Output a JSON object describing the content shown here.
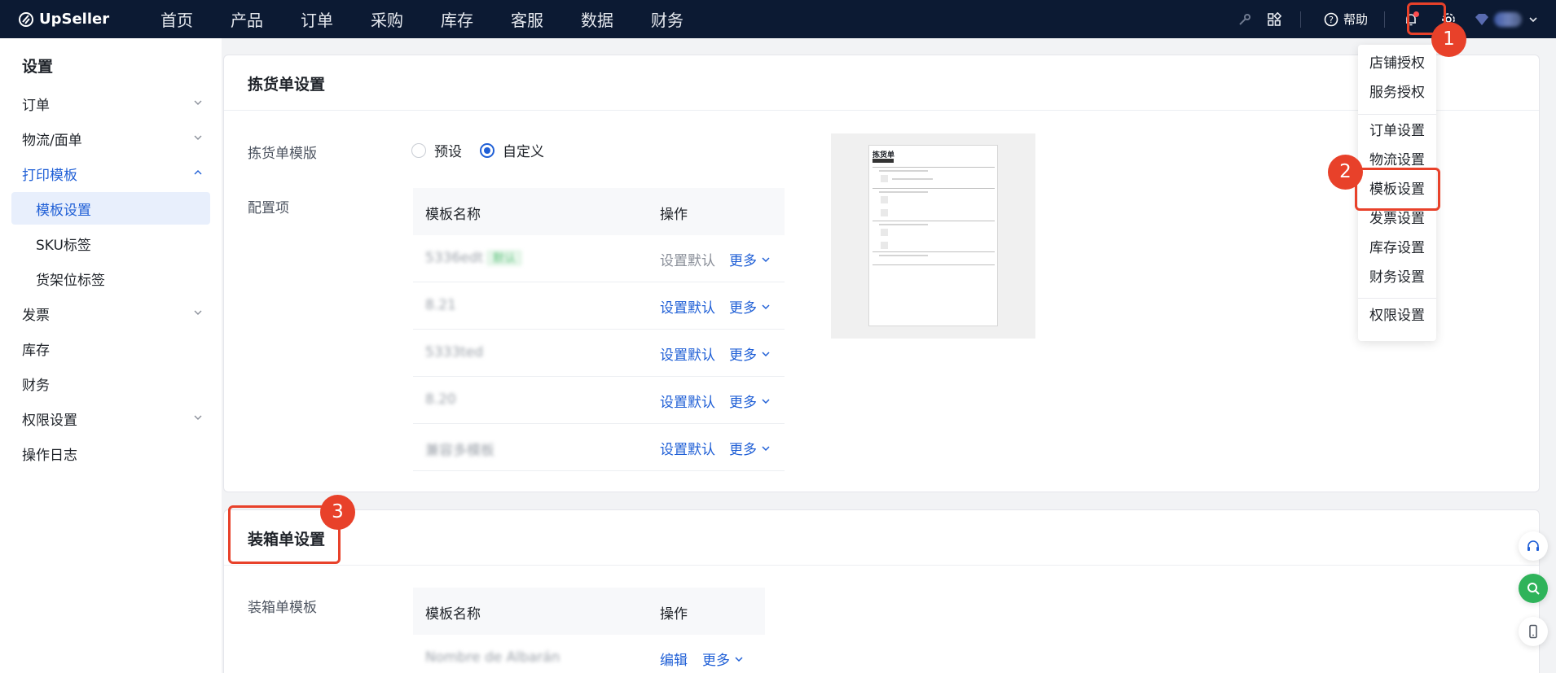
{
  "brand": {
    "name": "UpSeller"
  },
  "nav": {
    "items": [
      "首页",
      "产品",
      "订单",
      "采购",
      "库存",
      "客服",
      "数据",
      "财务"
    ],
    "help_label": "帮助"
  },
  "sidebar": {
    "title": "设置",
    "items": [
      {
        "label": "订单"
      },
      {
        "label": "物流/面单"
      },
      {
        "label": "打印模板"
      },
      {
        "label": "模板设置"
      },
      {
        "label": "SKU标签"
      },
      {
        "label": "货架位标签"
      },
      {
        "label": "发票"
      },
      {
        "label": "库存"
      },
      {
        "label": "财务"
      },
      {
        "label": "权限设置"
      },
      {
        "label": "操作日志"
      }
    ]
  },
  "picking": {
    "title": "拣货单设置",
    "template_label": "拣货单模版",
    "radio_preset": "预设",
    "radio_custom": "自定义",
    "config_label": "配置项",
    "col_name": "模板名称",
    "col_action": "操作",
    "rows": [
      {
        "name": "5336edt",
        "badge": "默认",
        "action": "设置默认",
        "more": "更多"
      },
      {
        "name": "8.21",
        "action": "设置默认",
        "more": "更多"
      },
      {
        "name": "5333ted",
        "action": "设置默认",
        "more": "更多"
      },
      {
        "name": "8.20",
        "action": "设置默认",
        "more": "更多"
      },
      {
        "name": "兼容多模板",
        "action": "设置默认",
        "more": "更多"
      }
    ],
    "preview_title": "拣货单"
  },
  "packing": {
    "title": "装箱单设置",
    "template_label": "装箱单模板",
    "col_name": "模板名称",
    "col_action": "操作",
    "rows": [
      {
        "name": "Nombre de Albarán",
        "action": "编辑",
        "more": "更多"
      }
    ]
  },
  "dropdown": {
    "items": [
      "店铺授权",
      "服务授权",
      "订单设置",
      "物流设置",
      "模板设置",
      "发票设置",
      "库存设置",
      "财务设置",
      "权限设置"
    ]
  },
  "steps": {
    "s1": "1",
    "s2": "2",
    "s3": "3"
  },
  "colors": {
    "accent": "#1f5fd6",
    "nav_bg": "#0c1a33",
    "annotation": "#e8412a"
  }
}
